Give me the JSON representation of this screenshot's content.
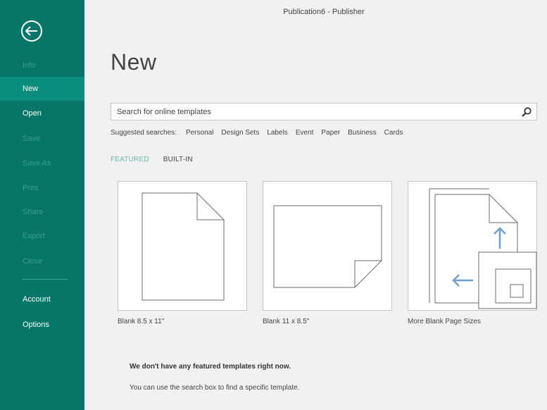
{
  "window": {
    "title": "Publication6 - Publisher"
  },
  "sidebar": {
    "items": [
      {
        "label": "Info",
        "state": "disabled"
      },
      {
        "label": "New",
        "state": "active"
      },
      {
        "label": "Open",
        "state": "enabled"
      },
      {
        "label": "Save",
        "state": "disabled"
      },
      {
        "label": "Save As",
        "state": "disabled"
      },
      {
        "label": "Print",
        "state": "disabled"
      },
      {
        "label": "Share",
        "state": "disabled"
      },
      {
        "label": "Export",
        "state": "disabled"
      },
      {
        "label": "Close",
        "state": "disabled"
      },
      {
        "label": "Account",
        "state": "enabled"
      },
      {
        "label": "Options",
        "state": "enabled"
      }
    ]
  },
  "main": {
    "title": "New",
    "search": {
      "placeholder": "Search for online templates",
      "value": ""
    },
    "suggested": {
      "label": "Suggested searches:",
      "items": [
        "Personal",
        "Design Sets",
        "Labels",
        "Event",
        "Paper",
        "Business",
        "Cards"
      ]
    },
    "tabs": [
      {
        "label": "FEATURED",
        "active": true
      },
      {
        "label": "BUILT-IN",
        "active": false
      }
    ],
    "templates": [
      {
        "label": "Blank 8.5 x 11\"",
        "icon": "portrait-page-icon"
      },
      {
        "label": "Blank 11 x 8.5\"",
        "icon": "landscape-page-icon"
      },
      {
        "label": "More Blank Page Sizes",
        "icon": "page-sizes-icon"
      }
    ],
    "message": {
      "headline": "We don't have any featured templates right now.",
      "hint": "You can use the search box to find a specific template."
    }
  },
  "colors": {
    "sidebar_bg": "#077568",
    "sidebar_active": "#0b8d7d",
    "sidebar_disabled_text": "#3f9c90",
    "tab_active": "#71b3ab",
    "arrow_blue": "#6d9fd0"
  }
}
